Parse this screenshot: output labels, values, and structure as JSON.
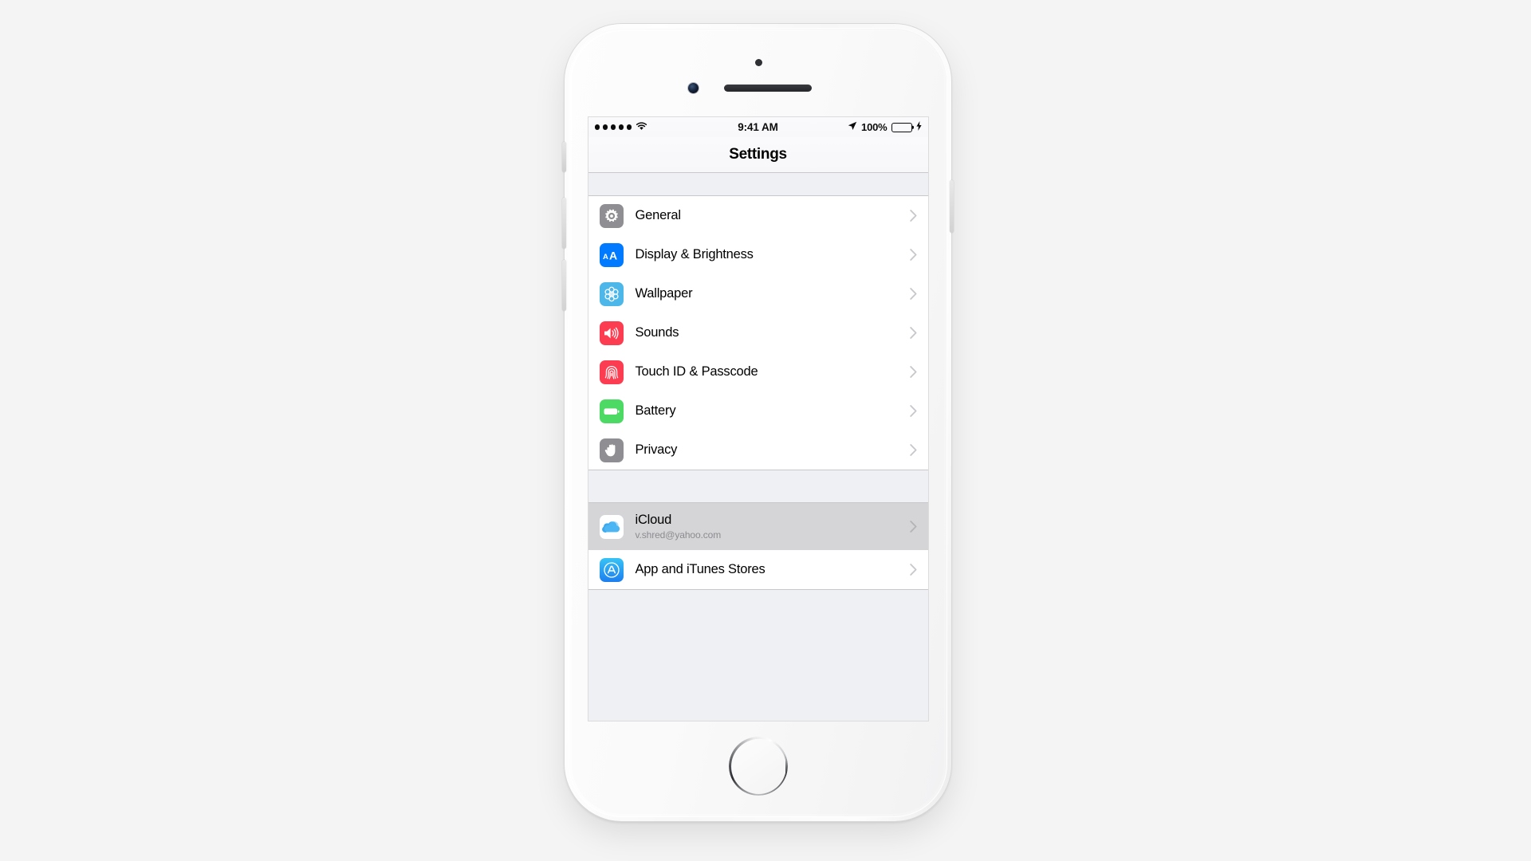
{
  "device": {
    "name": "iPhone 6s Silver",
    "hardware": {
      "earpiece": "earpiece-speaker",
      "front_camera": "front-camera",
      "proximity_sensor": "proximity-sensor",
      "home_button": "home-button",
      "mute_switch": "mute-switch",
      "volume_up": "volume-up-button",
      "volume_down": "volume-down-button",
      "power": "power-button"
    }
  },
  "status_bar": {
    "signal_dots_filled": 5,
    "signal_dots_total": 5,
    "wifi": "wifi-icon",
    "time": "9:41 AM",
    "location_icon": "location-arrow-icon",
    "battery_percent": "100%",
    "battery_level": 100,
    "battery_color": "#4cd964",
    "charging_icon": "lightning-bolt-icon"
  },
  "nav": {
    "title": "Settings"
  },
  "sections": [
    {
      "id": "system",
      "rows": [
        {
          "label": "General",
          "icon": "gear-icon",
          "icon_color": "#8e8e93",
          "accessory": "chevron-right-icon",
          "selected": false
        },
        {
          "label": "Display & Brightness",
          "icon": "text-size-icon",
          "icon_color": "#007aff",
          "accessory": "chevron-right-icon",
          "selected": false
        },
        {
          "label": "Wallpaper",
          "icon": "flower-icon",
          "icon_color": "#4cb7e8",
          "accessory": "chevron-right-icon",
          "selected": false
        },
        {
          "label": "Sounds",
          "icon": "speaker-icon",
          "icon_color": "#fc3d51",
          "accessory": "chevron-right-icon",
          "selected": false
        },
        {
          "label": "Touch ID & Passcode",
          "icon": "fingerprint-icon",
          "icon_color": "#fc3d51",
          "accessory": "chevron-right-icon",
          "selected": false
        },
        {
          "label": "Battery",
          "icon": "battery-icon",
          "icon_color": "#4cd964",
          "accessory": "chevron-right-icon",
          "selected": false
        },
        {
          "label": "Privacy",
          "icon": "hand-icon",
          "icon_color": "#8e8e93",
          "accessory": "chevron-right-icon",
          "selected": false
        }
      ]
    },
    {
      "id": "accounts",
      "rows": [
        {
          "label": "iCloud",
          "sublabel": "v.shred@yahoo.com",
          "icon": "icloud-icon",
          "icon_color": "#3aa9f0",
          "accessory": "chevron-right-icon",
          "selected": true
        },
        {
          "label": "App and iTunes Stores",
          "icon": "app-store-icon",
          "icon_color": "#3aa9f0",
          "accessory": "chevron-right-icon",
          "selected": false
        }
      ]
    }
  ],
  "colors": {
    "page_background": "#f4f4f4",
    "table_background": "#eff0f4",
    "row_background": "#ffffff",
    "row_selected": "#d5d5d7",
    "separator": "#c8c7cc",
    "label": "#000000",
    "sublabel": "#8c8c91",
    "chevron": "#c7c7cc"
  }
}
